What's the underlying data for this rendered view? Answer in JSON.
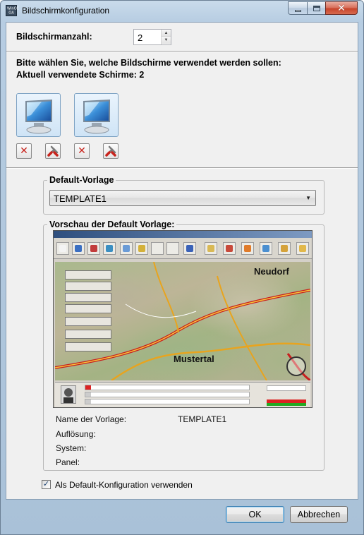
{
  "window": {
    "title": "Bildschirmkonfiguration",
    "app_icon_text": "WinCC OA"
  },
  "screen_count": {
    "label": "Bildschirmanzahl:",
    "value": "2"
  },
  "selection": {
    "instruction": "Bitte wählen Sie, welche Bildschirme verwendet werden sollen:",
    "current": "Aktuell verwendete Schirme: 2",
    "monitors": [
      {
        "icon": "monitor-icon",
        "remove_icon": "delete-icon",
        "config_icon": "tools-icon"
      },
      {
        "icon": "monitor-icon",
        "remove_icon": "delete-icon",
        "config_icon": "tools-icon"
      }
    ]
  },
  "default_template": {
    "group_label": "Default-Vorlage",
    "selected": "TEMPLATE1"
  },
  "preview": {
    "group_label": "Vorschau der Default Vorlage:",
    "map_towns": [
      "Neudorf",
      "Mustertal"
    ],
    "side_menu": [
      "",
      "",
      "",
      "",
      "",
      "",
      ""
    ],
    "info": {
      "name_label": "Name der Vorlage:",
      "name_value": "TEMPLATE1",
      "resolution_label": "Auflösung:",
      "system_label": "System:",
      "panel_label": "Panel:"
    }
  },
  "use_as_default": {
    "label": "Als Default-Konfiguration verwenden",
    "checked": true
  },
  "buttons": {
    "ok": "OK",
    "cancel": "Abbrechen"
  }
}
